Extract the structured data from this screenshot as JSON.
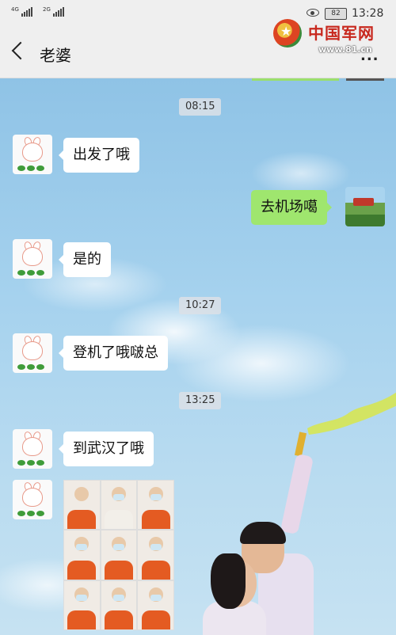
{
  "status_bar": {
    "signal1_label": "4G",
    "signal2_label": "2G",
    "battery": "82",
    "time": "13:28"
  },
  "header": {
    "back_icon": "chevron-left-icon",
    "title": "老婆",
    "more_icon": "more-dots-icon",
    "more_label": "..."
  },
  "watermark": {
    "name": "中国军网",
    "url": "www.81.cn"
  },
  "messages": [
    {
      "type": "time",
      "text": "08:15"
    },
    {
      "type": "incoming",
      "text": "出发了哦"
    },
    {
      "type": "outgoing",
      "text": "去机场噶"
    },
    {
      "type": "incoming",
      "text": "是的"
    },
    {
      "type": "time",
      "text": "10:27"
    },
    {
      "type": "incoming",
      "text": "登机了哦啵总"
    },
    {
      "type": "time",
      "text": "13:25"
    },
    {
      "type": "incoming",
      "text": "到武汉了哦"
    },
    {
      "type": "incoming-image",
      "photo_count": 9
    }
  ],
  "colors": {
    "incoming_bubble": "#ffffff",
    "outgoing_bubble": "#9fe66e",
    "watermark_red": "#c8281e"
  }
}
